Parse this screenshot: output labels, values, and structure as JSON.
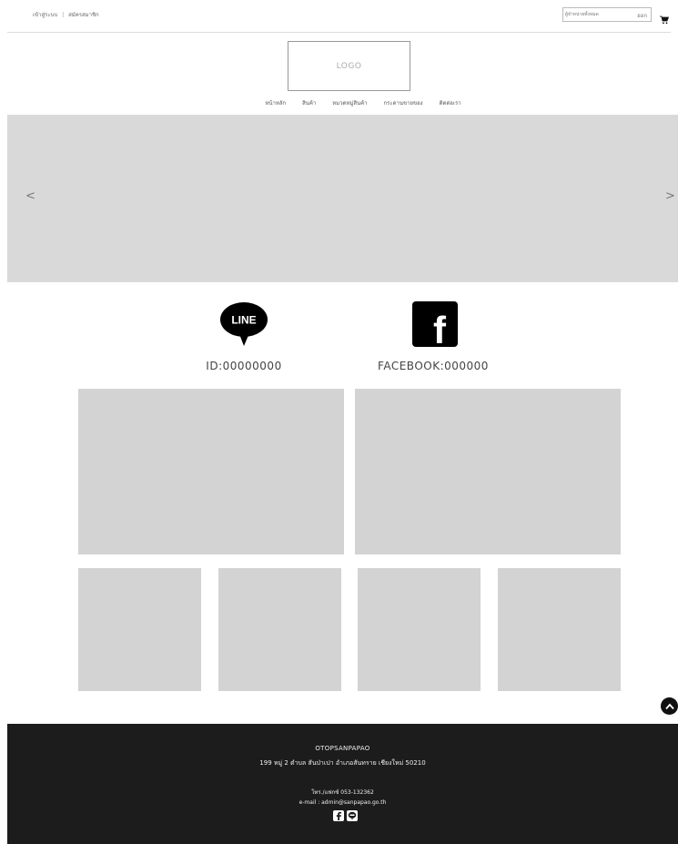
{
  "topbar": {
    "login_label": "เข้าสู่ระบบ",
    "separator": "|",
    "register_label": "สมัครสมาชิก",
    "search_placeholder": "ผู้จำหน่ายทั้งหมด",
    "search_button_label": "ออก",
    "cart_icon": "cart-icon"
  },
  "logo": {
    "text": "LOGO"
  },
  "nav": {
    "items": [
      "หน้าหลัก",
      "สินค้า",
      "หมวดหมู่สินค้า",
      "กระดานขายของ",
      "ติดต่อเรา"
    ]
  },
  "banner": {
    "prev_label": "<",
    "next_label": ">"
  },
  "social": {
    "line_icon_text": "LINE",
    "line_id": "ID:00000000",
    "facebook_icon_text": "f",
    "facebook_id": "FACEBOOK:000000"
  },
  "footer": {
    "name": "OTOPSANPAPAO",
    "address": "199 หมู่ 2 ตำบล สันป่าเปา อำเภอสันทราย เชียงใหม่ 50210",
    "phone": "โทร./แฟกซ์ 053-132362",
    "email": "e-mail : admin@sanpapao.go.th"
  },
  "colors": {
    "placeholder_gray": "#d3d3d3",
    "banner_gray": "#d9d9d9",
    "footer_bg": "#1c1c1c"
  }
}
